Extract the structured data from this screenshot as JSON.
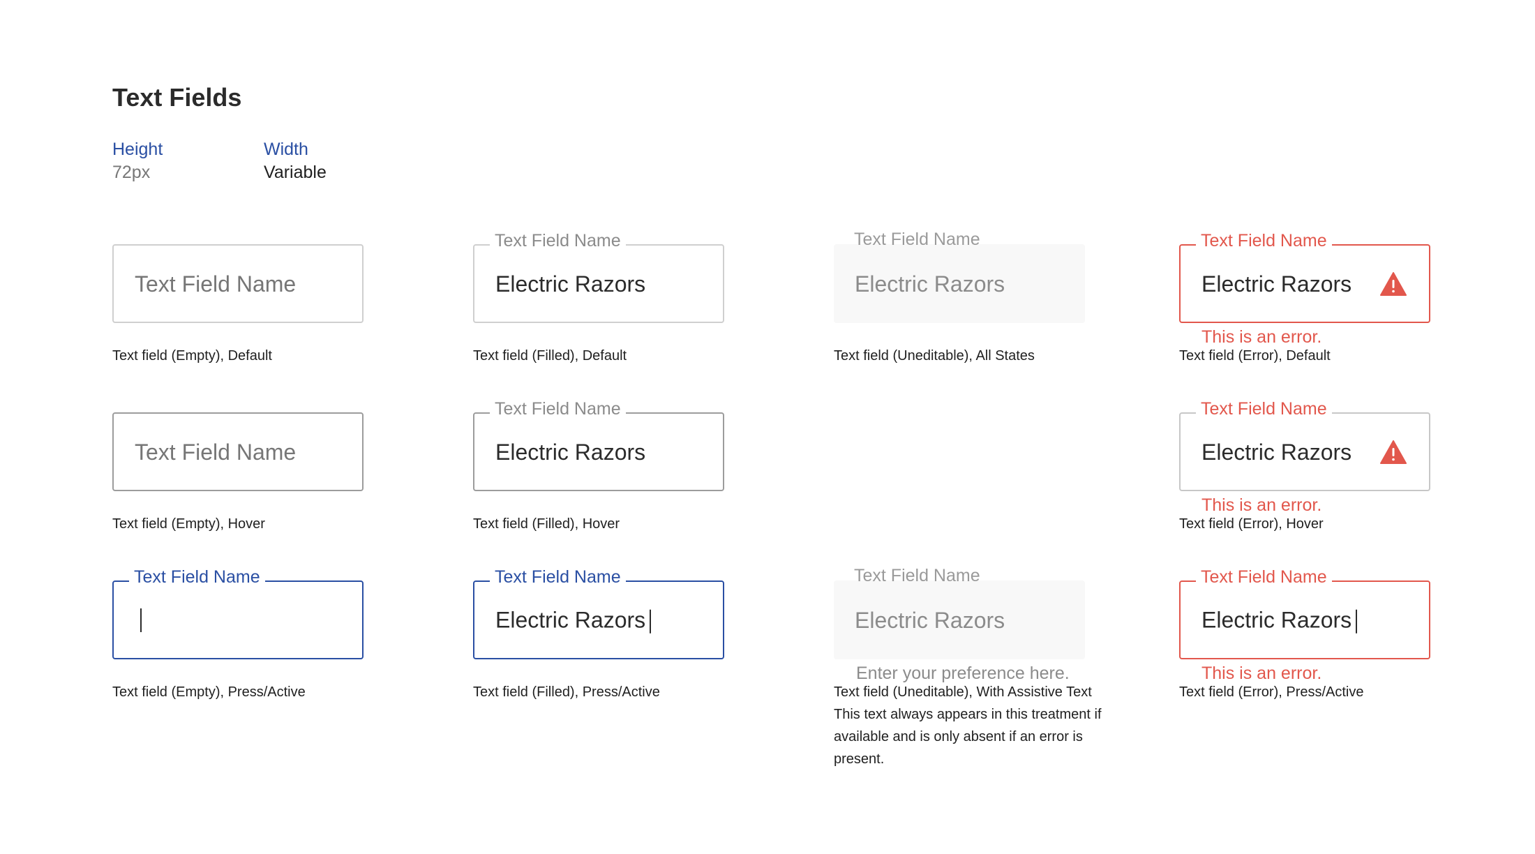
{
  "page": {
    "title": "Text Fields",
    "specs": [
      {
        "label": "Height",
        "value": "72px"
      },
      {
        "label": "Width",
        "value": "Variable"
      }
    ]
  },
  "colors": {
    "accent_blue": "#2a4fa3",
    "error_red": "#e2574c",
    "uneditable_bg": "#f8f8f8"
  },
  "fields": {
    "empty_default": {
      "placeholder": "Text Field Name",
      "caption": "Text field (Empty), Default"
    },
    "filled_default": {
      "label": "Text Field Name",
      "value": "Electric Razors",
      "caption": "Text field (Filled), Default"
    },
    "uneditable_all": {
      "label": "Text Field Name",
      "value": "Electric Razors",
      "caption": "Text field (Uneditable), All States"
    },
    "error_default": {
      "label": "Text Field Name",
      "value": "Electric Razors",
      "error": "This is an error.",
      "caption": "Text field (Error), Default",
      "icon": "warning-icon"
    },
    "empty_hover": {
      "placeholder": "Text Field Name",
      "caption": "Text field (Empty), Hover"
    },
    "filled_hover": {
      "label": "Text Field Name",
      "value": "Electric Razors",
      "caption": "Text field (Filled), Hover"
    },
    "error_hover": {
      "label": "Text Field Name",
      "value": "Electric Razors",
      "error": "This is an error.",
      "caption": "Text field (Error), Hover",
      "icon": "warning-icon"
    },
    "empty_active": {
      "label": "Text Field Name",
      "caption": "Text field (Empty), Press/Active"
    },
    "filled_active": {
      "label": "Text Field Name",
      "value": "Electric Razors",
      "caption": "Text field (Filled), Press/Active"
    },
    "uneditable_assist": {
      "label": "Text Field Name",
      "value": "Electric Razors",
      "helper": "Enter your preference here.",
      "caption_title": "Text field (Uneditable), With Assistive Text",
      "caption_body": "This text always appears in this treatment if available and is only absent if an error is present."
    },
    "error_active": {
      "label": "Text Field Name",
      "value": "Electric Razors",
      "error": "This is an error.",
      "caption": "Text field (Error), Press/Active"
    }
  }
}
